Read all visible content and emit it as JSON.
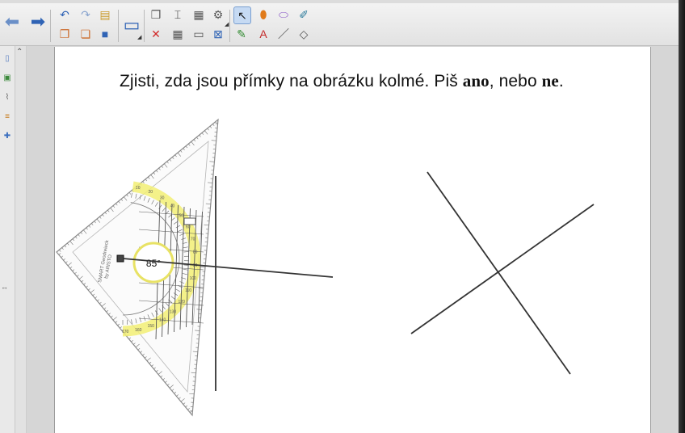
{
  "toolbar": {
    "buttons": [
      {
        "name": "back-button",
        "icon": "back-arrow-icon",
        "glyph": "⬅",
        "color": "#6a8fc7"
      },
      {
        "name": "forward-button",
        "icon": "forward-arrow-icon",
        "glyph": "➡",
        "color": "#2f63b5"
      },
      {
        "name": "undo-button",
        "icon": "undo-icon",
        "glyph": "↶",
        "color": "#2f63b5"
      },
      {
        "name": "redo-button",
        "icon": "redo-icon",
        "glyph": "↷",
        "color": "#8aa5cf"
      },
      {
        "name": "open-file-button",
        "icon": "folder-icon",
        "glyph": "▤",
        "color": "#c99a2a"
      },
      {
        "name": "new-page-button",
        "icon": "new-page-icon",
        "glyph": "❐",
        "color": "#cc6a2a"
      },
      {
        "name": "delete-page-button",
        "icon": "delete-page-icon",
        "glyph": "❏",
        "color": "#cc6a2a"
      },
      {
        "name": "save-button",
        "icon": "save-icon",
        "glyph": "■",
        "color": "#2f63b5"
      },
      {
        "name": "display-button",
        "icon": "monitor-icon",
        "glyph": "▭",
        "color": "#2f63b5"
      },
      {
        "name": "paste-button",
        "icon": "paste-icon",
        "glyph": "❒",
        "color": "#555555"
      },
      {
        "name": "delete-button",
        "icon": "delete-x-icon",
        "glyph": "✕",
        "color": "#d22a2a"
      },
      {
        "name": "screen-shade-button",
        "icon": "screen-shade-icon",
        "glyph": "▦",
        "color": "#555555"
      },
      {
        "name": "screen-button",
        "icon": "screen-icon",
        "glyph": "▭",
        "color": "#555555"
      },
      {
        "name": "capture-button",
        "icon": "capture-icon",
        "glyph": "⌶",
        "color": "#333333"
      },
      {
        "name": "table-button",
        "icon": "table-icon",
        "glyph": "▦",
        "color": "#555555"
      },
      {
        "name": "measure-tools-button",
        "icon": "measure-tools-icon",
        "glyph": "⚙",
        "color": "#555555"
      },
      {
        "name": "close-view-button",
        "icon": "close-box-icon",
        "glyph": "⊠",
        "color": "#2f63b5"
      },
      {
        "name": "select-tool",
        "icon": "cursor-icon",
        "glyph": "↖",
        "color": "#1a1a1a"
      },
      {
        "name": "pens-tool",
        "icon": "pens-icon",
        "glyph": "✎",
        "color": "#2f8a2f"
      },
      {
        "name": "highlighter-tool",
        "icon": "highlighter-icon",
        "glyph": "⬮",
        "color": "#e07a1a"
      },
      {
        "name": "text-tool",
        "icon": "text-a-icon",
        "glyph": "A",
        "color": "#c42a2a"
      },
      {
        "name": "eraser-tool",
        "icon": "eraser-icon",
        "glyph": "⬭",
        "color": "#8a5ac7"
      },
      {
        "name": "line-tool",
        "icon": "line-icon",
        "glyph": "／",
        "color": "#333333"
      },
      {
        "name": "shape-eraser-tool",
        "icon": "shape-eraser-icon",
        "glyph": "◇",
        "color": "#555555"
      },
      {
        "name": "magic-pen-tool",
        "icon": "magic-pen-icon",
        "glyph": "✐",
        "color": "#2a7a9a"
      }
    ]
  },
  "sidebar": {
    "tabs": [
      {
        "name": "page-sorter-tab",
        "icon": "page-icon",
        "glyph": "▯",
        "color": "#5a7fbf"
      },
      {
        "name": "gallery-tab",
        "icon": "image-icon",
        "glyph": "▣",
        "color": "#3d8a3d"
      },
      {
        "name": "attachments-tab",
        "icon": "paperclip-icon",
        "glyph": "⌇",
        "color": "#666666"
      },
      {
        "name": "properties-tab",
        "icon": "properties-icon",
        "glyph": "≡",
        "color": "#c77a1a"
      },
      {
        "name": "addons-tab",
        "icon": "puzzle-icon",
        "glyph": "✚",
        "color": "#3a6fbf"
      }
    ],
    "collapse_glyph": "⌃",
    "resize_glyph": "↔"
  },
  "page": {
    "task_prefix": "Zjisti, zda jsou přímky na obrázku kolmé. Piš ",
    "answer_yes": "ano",
    "task_middle": ", nebo ",
    "answer_no": "ne",
    "task_suffix": "."
  },
  "protractor": {
    "angle_readout": "85°",
    "brand_line1": "SMART Geodreieck",
    "brand_line2": "by ARISTO",
    "inner_scale": [
      "10",
      "20",
      "30",
      "40",
      "50",
      "60",
      "70",
      "80",
      "90",
      "100",
      "110",
      "120",
      "130",
      "140",
      "150",
      "160",
      "170"
    ],
    "highlight_color": "#f2ee74"
  },
  "colors": {
    "selected_tool_bg": "#c6daf3",
    "line_color": "#333333"
  }
}
